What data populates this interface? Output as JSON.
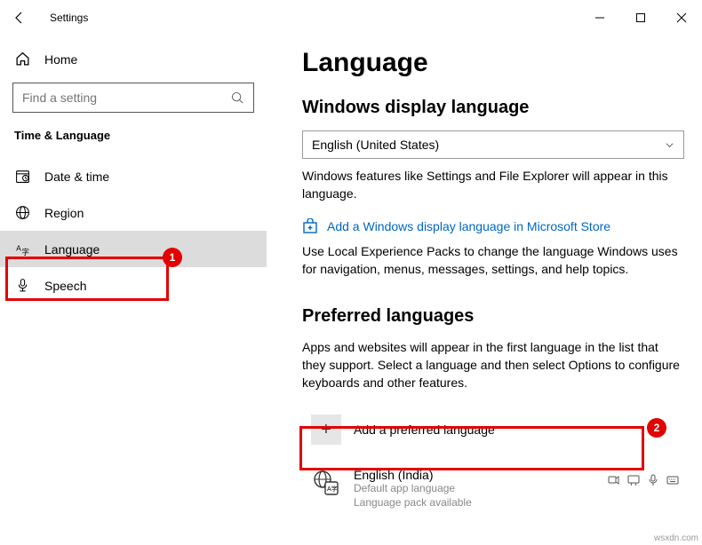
{
  "titlebar": {
    "app_title": "Settings"
  },
  "sidebar": {
    "home": "Home",
    "search_placeholder": "Find a setting",
    "category": "Time & Language",
    "items": [
      {
        "label": "Date & time"
      },
      {
        "label": "Region"
      },
      {
        "label": "Language"
      },
      {
        "label": "Speech"
      }
    ]
  },
  "main": {
    "title": "Language",
    "display_section": {
      "heading": "Windows display language",
      "selected": "English (United States)",
      "desc": "Windows features like Settings and File Explorer will appear in this language.",
      "store_link": "Add a Windows display language in Microsoft Store",
      "lep_desc": "Use Local Experience Packs to change the language Windows uses for navigation, menus, messages, settings, and help topics."
    },
    "preferred_section": {
      "heading": "Preferred languages",
      "desc": "Apps and websites will appear in the first language in the list that they support. Select a language and then select Options to configure keyboards and other features.",
      "add_label": "Add a preferred language",
      "languages": [
        {
          "name": "English (India)",
          "sub1": "Default app language",
          "sub2": "Language pack available"
        }
      ]
    }
  },
  "annotations": {
    "badge1": "1",
    "badge2": "2"
  },
  "attribution": "wsxdn.com"
}
